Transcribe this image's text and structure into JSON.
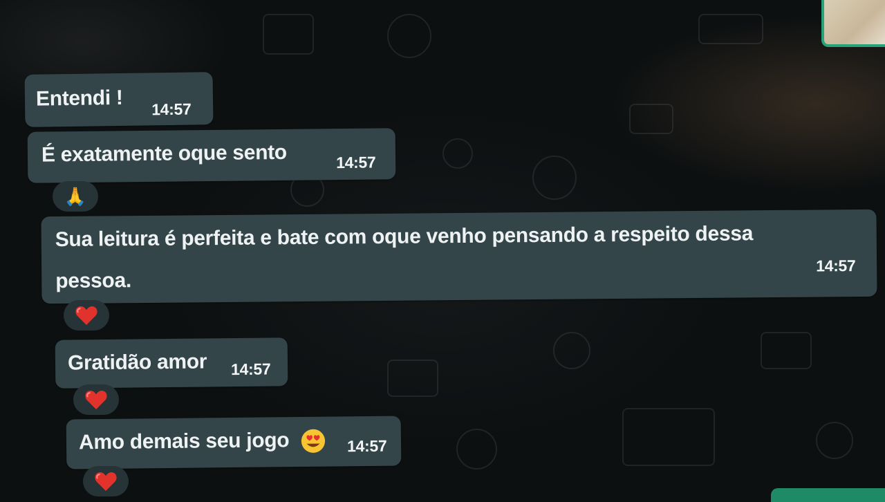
{
  "messages": [
    {
      "text": "Entendi !",
      "time": "14:57",
      "reaction": ""
    },
    {
      "text": "É exatamente oque sento",
      "time": "14:57",
      "reaction": "🙏"
    },
    {
      "text_line1": "Sua leitura é perfeita e bate com oque venho pensando a respeito dessa",
      "text_line2": "pessoa.",
      "time": "14:57",
      "reaction": "❤️"
    },
    {
      "text": "Gratidão amor",
      "time": "14:57",
      "reaction": "❤️"
    },
    {
      "text": "Amo demais seu jogo",
      "emoji": "😍",
      "time": "14:57",
      "reaction": "❤️"
    }
  ],
  "colors": {
    "bubble": "#34454a",
    "wallpaper": "#0d1011",
    "accent_green": "#27a37a"
  }
}
